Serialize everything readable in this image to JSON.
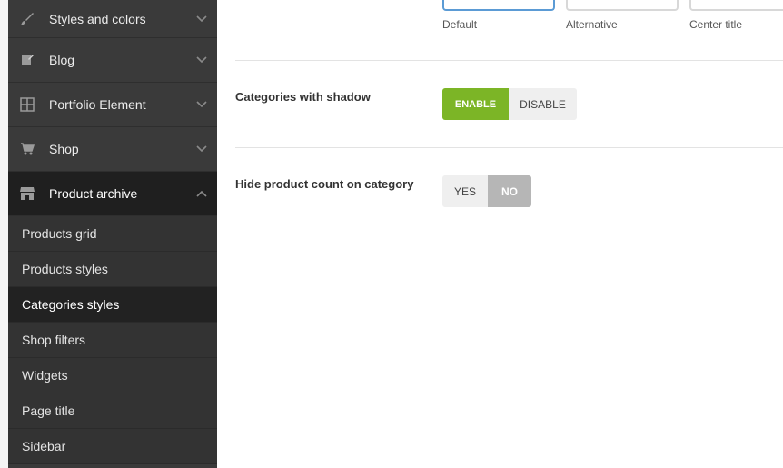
{
  "sidebar": {
    "items": [
      {
        "label": "Styles and colors",
        "icon": "brush-icon",
        "expanded": false
      },
      {
        "label": "Blog",
        "icon": "edit-icon",
        "expanded": false
      },
      {
        "label": "Portfolio Element",
        "icon": "grid-icon",
        "expanded": false
      },
      {
        "label": "Shop",
        "icon": "cart-icon",
        "expanded": false
      },
      {
        "label": "Product archive",
        "icon": "store-icon",
        "expanded": true
      }
    ],
    "subitems": [
      {
        "label": "Products grid"
      },
      {
        "label": "Products styles"
      },
      {
        "label": "Categories styles",
        "active": true
      },
      {
        "label": "Shop filters"
      },
      {
        "label": "Widgets"
      },
      {
        "label": "Page title"
      },
      {
        "label": "Sidebar"
      }
    ]
  },
  "layout_options": [
    {
      "label": "Default",
      "selected": true
    },
    {
      "label": "Alternative",
      "selected": false
    },
    {
      "label": "Center title",
      "selected": false
    }
  ],
  "settings": {
    "shadow": {
      "label": "Categories with shadow",
      "options": [
        "ENABLE",
        "DISABLE"
      ],
      "value": "ENABLE"
    },
    "product_count": {
      "label": "Hide product count on category",
      "options": [
        "YES",
        "NO"
      ],
      "value": "NO"
    }
  },
  "colors": {
    "accent_green": "#7cb526",
    "sidebar_bg": "#3a3a3a",
    "selected_border": "#5b9bd5"
  }
}
